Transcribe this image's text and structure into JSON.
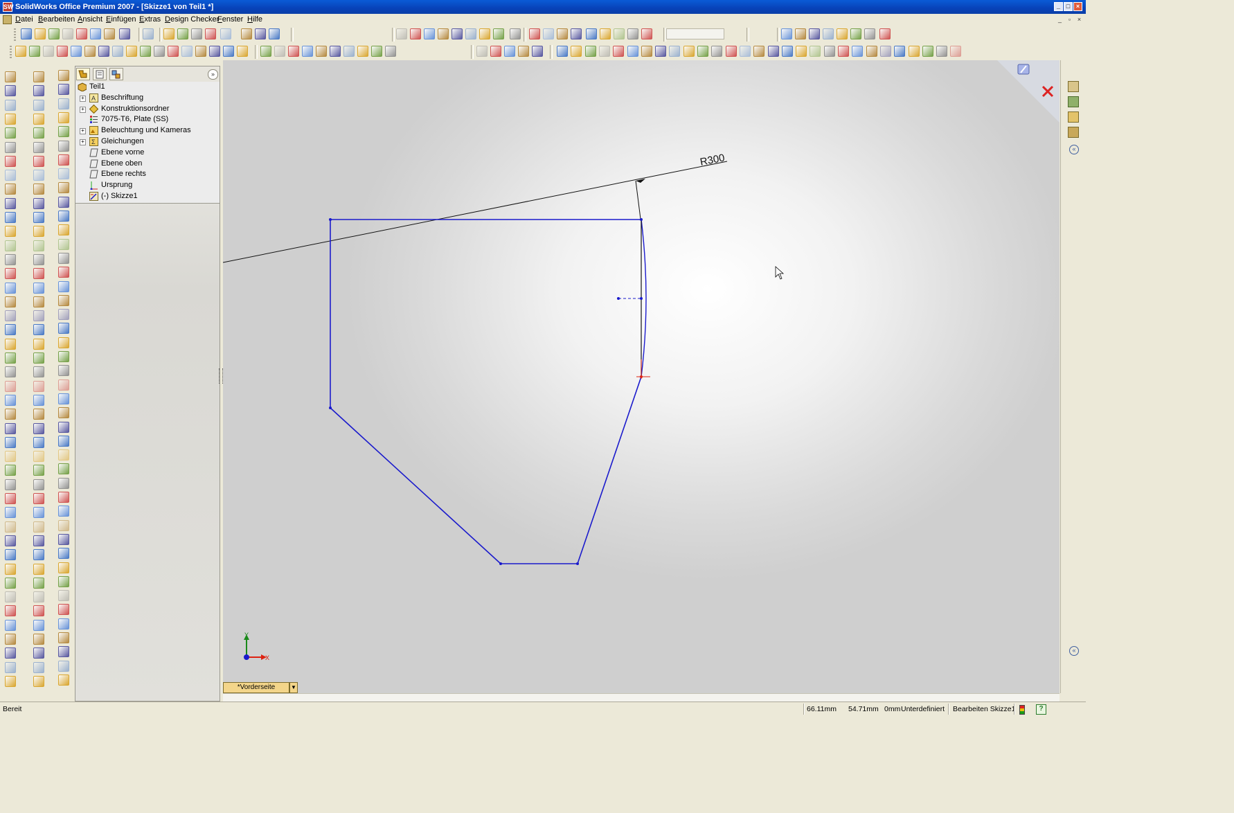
{
  "window": {
    "title": "SolidWorks Office Premium 2007 - [Skizze1 von Teil1 *]",
    "app_icon_label": "SW"
  },
  "menubar": {
    "items": [
      "Datei",
      "Bearbeiten",
      "Ansicht",
      "Einfügen",
      "Extras",
      "Design Checker",
      "Fenster",
      "Hilfe"
    ]
  },
  "feature_manager": {
    "tree": [
      {
        "label": "Teil1",
        "icon": "part-icon",
        "expandable": false,
        "root": true
      },
      {
        "label": "Beschriftung",
        "icon": "annotations-icon",
        "expandable": true
      },
      {
        "label": "Konstruktionsordner",
        "icon": "design-binder-icon",
        "expandable": true
      },
      {
        "label": "7075-T6, Plate (SS)",
        "icon": "material-icon",
        "expandable": false
      },
      {
        "label": "Beleuchtung und Kameras",
        "icon": "lights-cameras-icon",
        "expandable": true
      },
      {
        "label": "Gleichungen",
        "icon": "equations-icon",
        "expandable": true
      },
      {
        "label": "Ebene vorne",
        "icon": "plane-icon",
        "expandable": false
      },
      {
        "label": "Ebene oben",
        "icon": "plane-icon",
        "expandable": false
      },
      {
        "label": "Ebene rechts",
        "icon": "plane-icon",
        "expandable": false
      },
      {
        "label": "Ursprung",
        "icon": "origin-icon",
        "expandable": false
      },
      {
        "label": "(-) Skizze1",
        "icon": "sketch-icon",
        "expandable": false
      }
    ]
  },
  "sketch": {
    "dimension_label": "R300",
    "line_color": "#1a1acc",
    "triad": {
      "x_label": "X",
      "y_label": "Y"
    }
  },
  "view_tab": {
    "label": "*Vorderseite"
  },
  "statusbar": {
    "status": "Bereit",
    "x_coord": "66.11mm",
    "y_coord": "54.71mm",
    "z_coord": "0mm",
    "sketch_state": "Unterdefiniert",
    "edit_mode": "Bearbeiten Skizze1",
    "help_icon": "?"
  },
  "colors": {
    "titlebar": "#0a4fc8",
    "sketch_blue": "#1a1acc",
    "view_tab": "#f3d58a"
  }
}
